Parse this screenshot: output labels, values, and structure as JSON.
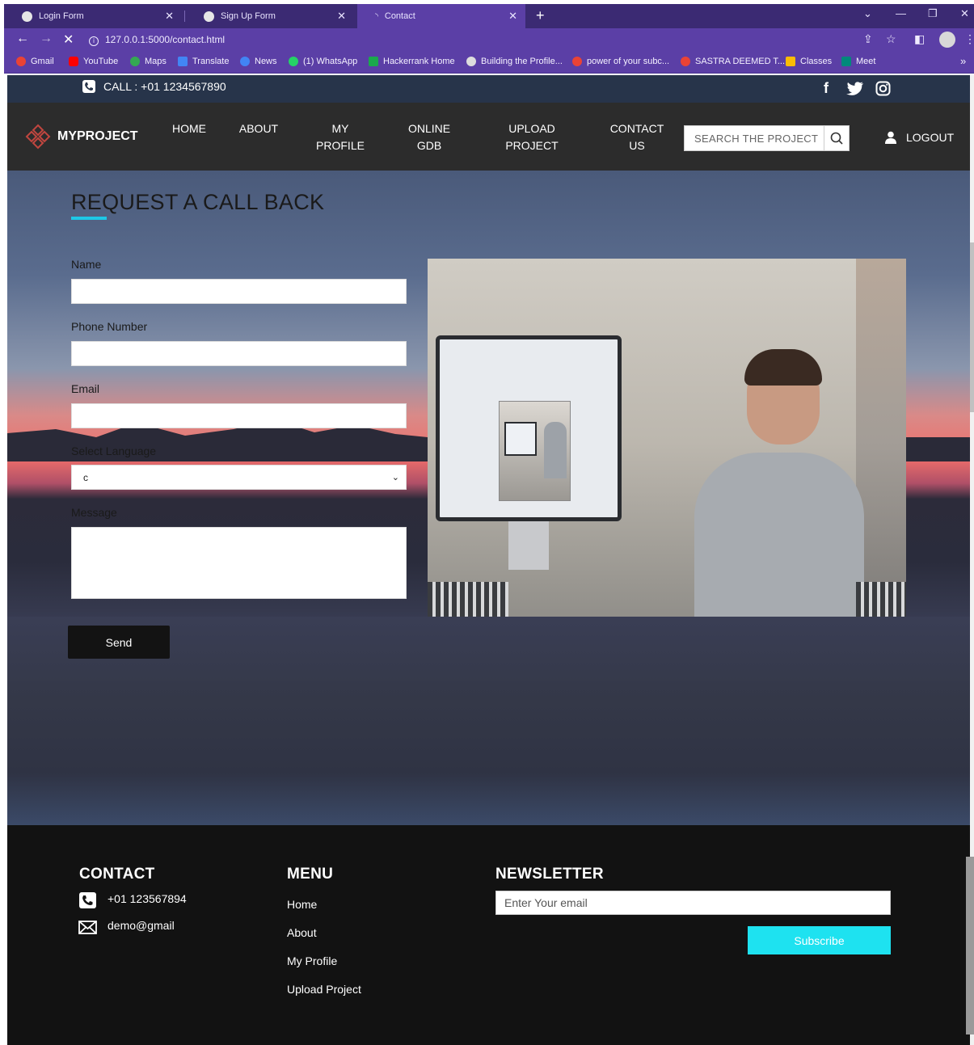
{
  "browser": {
    "tabs": [
      {
        "label": "Login Form"
      },
      {
        "label": "Sign Up Form"
      },
      {
        "label": "Contact"
      }
    ],
    "url": "127.0.0.1:5000/contact.html",
    "bookmarks": [
      {
        "label": "Gmail",
        "color": "#ea4335"
      },
      {
        "label": "YouTube",
        "color": "#ff0000"
      },
      {
        "label": "Maps",
        "color": "#34a853"
      },
      {
        "label": "Translate",
        "color": "#4285f4"
      },
      {
        "label": "News",
        "color": "#4285f4"
      },
      {
        "label": "(1) WhatsApp",
        "color": "#25d366"
      },
      {
        "label": "Hackerrank Home",
        "color": "#1ba94c"
      },
      {
        "label": "Building the Profile...",
        "color": "#dddddd"
      },
      {
        "label": "power of your subc...",
        "color": "#ea4335"
      },
      {
        "label": "SASTRA DEEMED T...",
        "color": "#ea4335"
      },
      {
        "label": "Classes",
        "color": "#fbbc05"
      },
      {
        "label": "Meet",
        "color": "#00897b"
      }
    ],
    "more_bookmarks": "»"
  },
  "topbar": {
    "call": "CALL : +01 1234567890",
    "social": [
      "facebook-icon",
      "twitter-icon",
      "instagram-icon"
    ]
  },
  "nav": {
    "brand": "MYPROJECT",
    "items": [
      {
        "line1": "HOME",
        "line2": ""
      },
      {
        "line1": "ABOUT",
        "line2": ""
      },
      {
        "line1": "MY",
        "line2": "PROFILE"
      },
      {
        "line1": "ONLINE",
        "line2": "GDB"
      },
      {
        "line1": "UPLOAD",
        "line2": "PROJECT"
      },
      {
        "line1": "CONTACT",
        "line2": "US"
      }
    ],
    "search_placeholder": "SEARCH THE PROJECT",
    "logout": "LOGOUT"
  },
  "form": {
    "title": "REQUEST A CALL BACK",
    "name_label": "Name",
    "phone_label": "Phone Number",
    "email_label": "Email",
    "language_label": "Select Language",
    "language_value": "c",
    "message_label": "Message",
    "send": "Send"
  },
  "footer": {
    "contact_title": "CONTACT",
    "phone": "+01 123567894",
    "email": "demo@gmail",
    "menu_title": "MENU",
    "menu": [
      "Home",
      "About",
      "My Profile",
      "Upload Project"
    ],
    "newsletter_title": "NEWSLETTER",
    "newsletter_placeholder": "Enter Your email",
    "subscribe": "Subscribe"
  },
  "colors": {
    "accent": "#1ec8e6",
    "subscribe": "#1ee2f0",
    "browser": "#5b3fa6"
  }
}
